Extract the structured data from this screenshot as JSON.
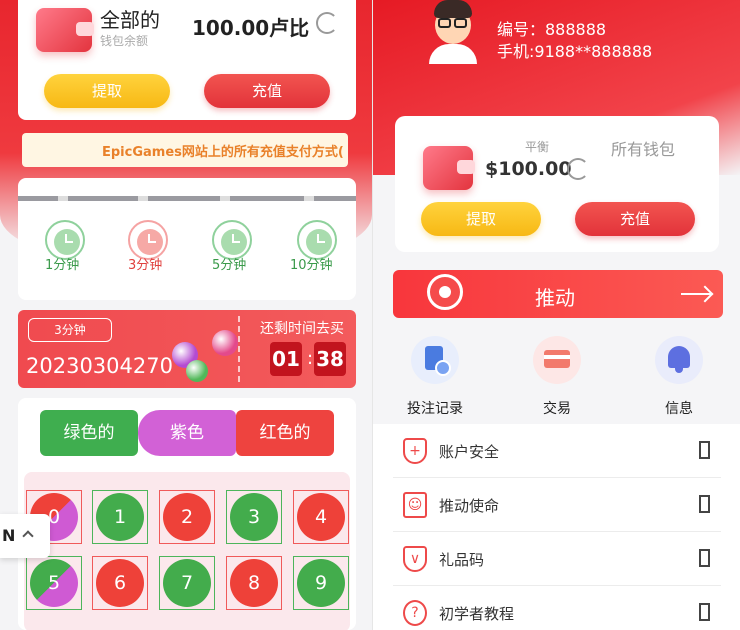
{
  "left_panel": {
    "wallet": {
      "title": "全部的",
      "subtitle": "钱包余额",
      "amount": "100.00卢比",
      "withdraw_label": "提取",
      "recharge_label": "充值"
    },
    "marquee": {
      "text": "EpicGames网站上的所有充值支付方式("
    },
    "timer_tabs": [
      {
        "label": "1分钟",
        "state": "inactive"
      },
      {
        "label": "3分钟",
        "state": "active"
      },
      {
        "label": "5分钟",
        "state": "inactive"
      },
      {
        "label": "10分钟",
        "state": "inactive"
      }
    ],
    "round": {
      "badge": "3分钟",
      "number": "20230304270",
      "countdown_label": "还剩时间去买",
      "minutes": "01",
      "seconds": "38"
    },
    "color_buttons": {
      "green": "绿色的",
      "purple": "紫色",
      "red": "红色的"
    },
    "numbers": [
      {
        "value": "0",
        "color": "red-purple"
      },
      {
        "value": "1",
        "color": "green"
      },
      {
        "value": "2",
        "color": "red"
      },
      {
        "value": "3",
        "color": "green"
      },
      {
        "value": "4",
        "color": "red"
      },
      {
        "value": "5",
        "color": "green-purple"
      },
      {
        "value": "6",
        "color": "red"
      },
      {
        "value": "7",
        "color": "green"
      },
      {
        "value": "8",
        "color": "red"
      },
      {
        "value": "9",
        "color": "green"
      }
    ],
    "language": {
      "code": "N"
    }
  },
  "right_panel": {
    "user": {
      "id_line": "编号：888888",
      "phone_line": "手机:9188**888888"
    },
    "wallet": {
      "balance_label": "平衡",
      "balance": "$100.00",
      "all_wallets": "所有钱包",
      "withdraw_label": "提取",
      "recharge_label": "充值"
    },
    "promo": {
      "label": "推动"
    },
    "quick_actions": [
      {
        "label": "投注记录",
        "icon": "bet-record-icon"
      },
      {
        "label": "交易",
        "icon": "transaction-icon"
      },
      {
        "label": "信息",
        "icon": "bell-icon"
      }
    ],
    "menu": [
      {
        "label": "账户安全",
        "icon": "shield-icon"
      },
      {
        "label": "推动使命",
        "icon": "mission-icon"
      },
      {
        "label": "礼品码",
        "icon": "gift-icon"
      },
      {
        "label": "初学者教程",
        "icon": "help-icon"
      }
    ]
  },
  "colors": {
    "brand_red": "#e8262e",
    "button_yellow": "#f7b814",
    "green": "#43ac4c",
    "purple": "#cf5ad3",
    "red": "#ee4139"
  }
}
